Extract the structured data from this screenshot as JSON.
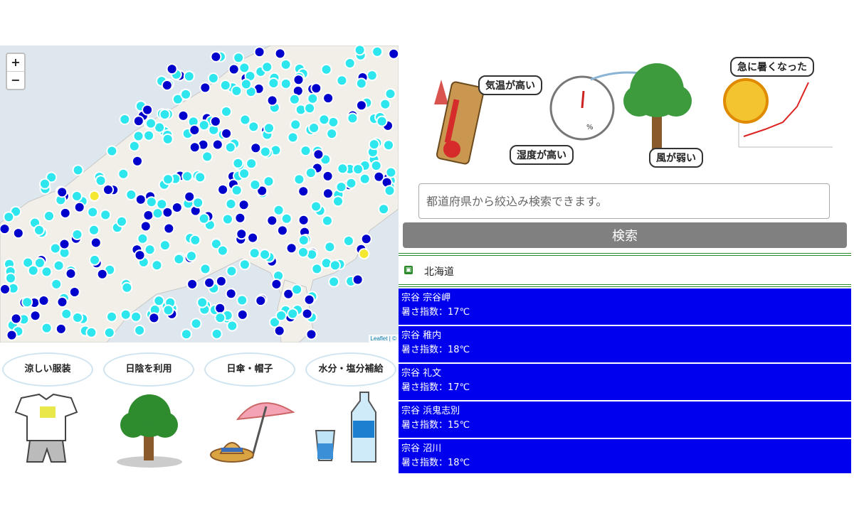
{
  "map": {
    "zoom_in": "+",
    "zoom_out": "−",
    "attribution_link": "Leaflet",
    "attribution_sep": " | © ",
    "colors": {
      "cyan": "#2ee6ee",
      "blue": "#0000cc",
      "yellow": "#f5e830",
      "background": "#dfe7ee"
    }
  },
  "tips": [
    {
      "label": "涼しい服装",
      "icon": "tshirt-shorts-icon"
    },
    {
      "label": "日陰を利用",
      "icon": "tree-icon"
    },
    {
      "label": "日傘・帽子",
      "icon": "umbrella-hat-icon"
    },
    {
      "label": "水分・塩分補給",
      "icon": "water-bottle-icon"
    }
  ],
  "illustration": {
    "temp_label": "気温が高い",
    "humidity_label": "湿度が高い",
    "wind_label": "風が弱い",
    "sudden_label": "急に暑くなった",
    "gauge_unit": "%"
  },
  "search": {
    "placeholder": "都道府県から絞込み検索できます。",
    "button": "検索"
  },
  "prefecture": {
    "name": "北海道",
    "color": "#2a8a2a"
  },
  "stations": [
    {
      "name": "宗谷 宗谷岬",
      "index": "暑さ指数：17℃"
    },
    {
      "name": "宗谷 稚内",
      "index": "暑さ指数：18℃"
    },
    {
      "name": "宗谷 礼文",
      "index": "暑さ指数：17℃"
    },
    {
      "name": "宗谷 浜鬼志別",
      "index": "暑さ指数：15℃"
    },
    {
      "name": "宗谷 沼川",
      "index": "暑さ指数：18℃"
    }
  ],
  "station_color": "#0000ee"
}
